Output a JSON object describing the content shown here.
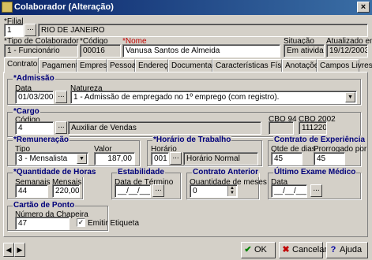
{
  "window": {
    "title": "Colaborador (Alteração)",
    "close": "×"
  },
  "header": {
    "filial_label": "*Filial",
    "filial_code": "1",
    "filial_name": "RIO DE JANEIRO",
    "tipo_label": "*Tipo de Colaborador",
    "tipo_value": "1 - Funcionário",
    "codigo_label": "*Código",
    "codigo_value": "00016",
    "nome_label": "*Nome",
    "nome_value": "Vanusa Santos de Almeida",
    "situacao_label": "Situação",
    "situacao_value": "Em atividade",
    "atualizado_label": "Atualizado em",
    "atualizado_value": "19/12/2003"
  },
  "tabs": [
    "Contrato",
    "Pagamento",
    "Empresa",
    "Pessoal",
    "Endereço",
    "Documentação",
    "Características Físicas",
    "Anotações",
    "Campos Livres"
  ],
  "admissao": {
    "title": "*Admissão",
    "data_label": "Data",
    "data_value": "01/03/2000",
    "natureza_label": "Natureza",
    "natureza_value": "1 - Admissão de empregado no 1º emprego (com registro)."
  },
  "cargo": {
    "title": "*Cargo",
    "codigo_label": "Código",
    "codigo_value": "4",
    "descricao_value": "Auxiliar de Vendas",
    "cbo94_label": "CBO 94",
    "cbo94_value": "",
    "cbo2002_label": "CBO 2002",
    "cbo2002_value": "111220"
  },
  "remuneracao": {
    "title": "*Remuneração",
    "tipo_label": "Tipo",
    "tipo_value": "3 - Mensalista",
    "valor_label": "Valor",
    "valor_value": "187,00"
  },
  "horario": {
    "title": "*Horário de Trabalho",
    "horario_label": "Horário",
    "codigo_value": "001",
    "descricao_value": "Horário Normal"
  },
  "experiencia": {
    "title": "Contrato de Experiência",
    "qtde_label": "Qtde de dias",
    "qtde_value": "45",
    "prorrogado_label": "Prorrogado por",
    "prorrogado_value": "45"
  },
  "horas": {
    "title": "*Quantidade de Horas",
    "semanais_label": "Semanais",
    "semanais_value": "44",
    "mensais_label": "Mensais",
    "mensais_value": "220,00"
  },
  "estabilidade": {
    "title": "Estabilidade",
    "data_label": "Data de Término",
    "data_value": "__/__/____"
  },
  "contrato_anterior": {
    "title": "Contrato Anterior",
    "qtde_label": "Quantidade de meses",
    "qtde_value": "0"
  },
  "exame": {
    "title": "Último Exame Médico",
    "data_label": "Data",
    "data_value": "__/__/____"
  },
  "ponto": {
    "title": "Cartão de Ponto",
    "chapeira_label": "Número da Chapeira",
    "chapeira_value": "47",
    "emitir_label": "Emitir Etiqueta",
    "emitir_checked": true
  },
  "buttons": {
    "ok": "OK",
    "cancelar": "Cancelar",
    "ajuda": "Ajuda",
    "dots": "..."
  },
  "colors": {
    "title_start": "#0a246a",
    "title_end": "#3a6ea5",
    "group_title": "#00007a",
    "required_name": "#c00000",
    "face": "#d4d0c8"
  }
}
